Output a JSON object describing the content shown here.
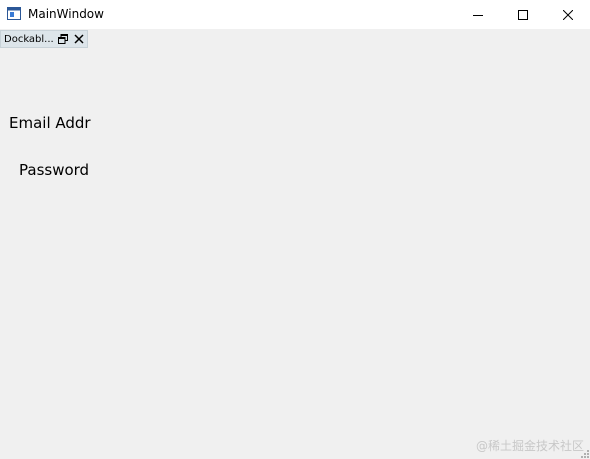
{
  "window": {
    "title": "MainWindow",
    "app_icon": "window-app-icon",
    "controls": {
      "minimize_icon": "minimize-icon",
      "maximize_icon": "maximize-icon",
      "close_icon": "close-icon"
    }
  },
  "dock": {
    "title": "Dockabl...",
    "float_icon": "float-icon",
    "close_icon": "close-icon"
  },
  "form": {
    "email_label": "Email Addr",
    "password_label": "Password"
  },
  "watermark": {
    "text": "@稀土掘金技术社区"
  },
  "colors": {
    "window_background": "#f0f0f0",
    "titlebar_background": "#ffffff",
    "dock_title_background": "#dde5ea",
    "watermark": "#c8c8c8"
  }
}
